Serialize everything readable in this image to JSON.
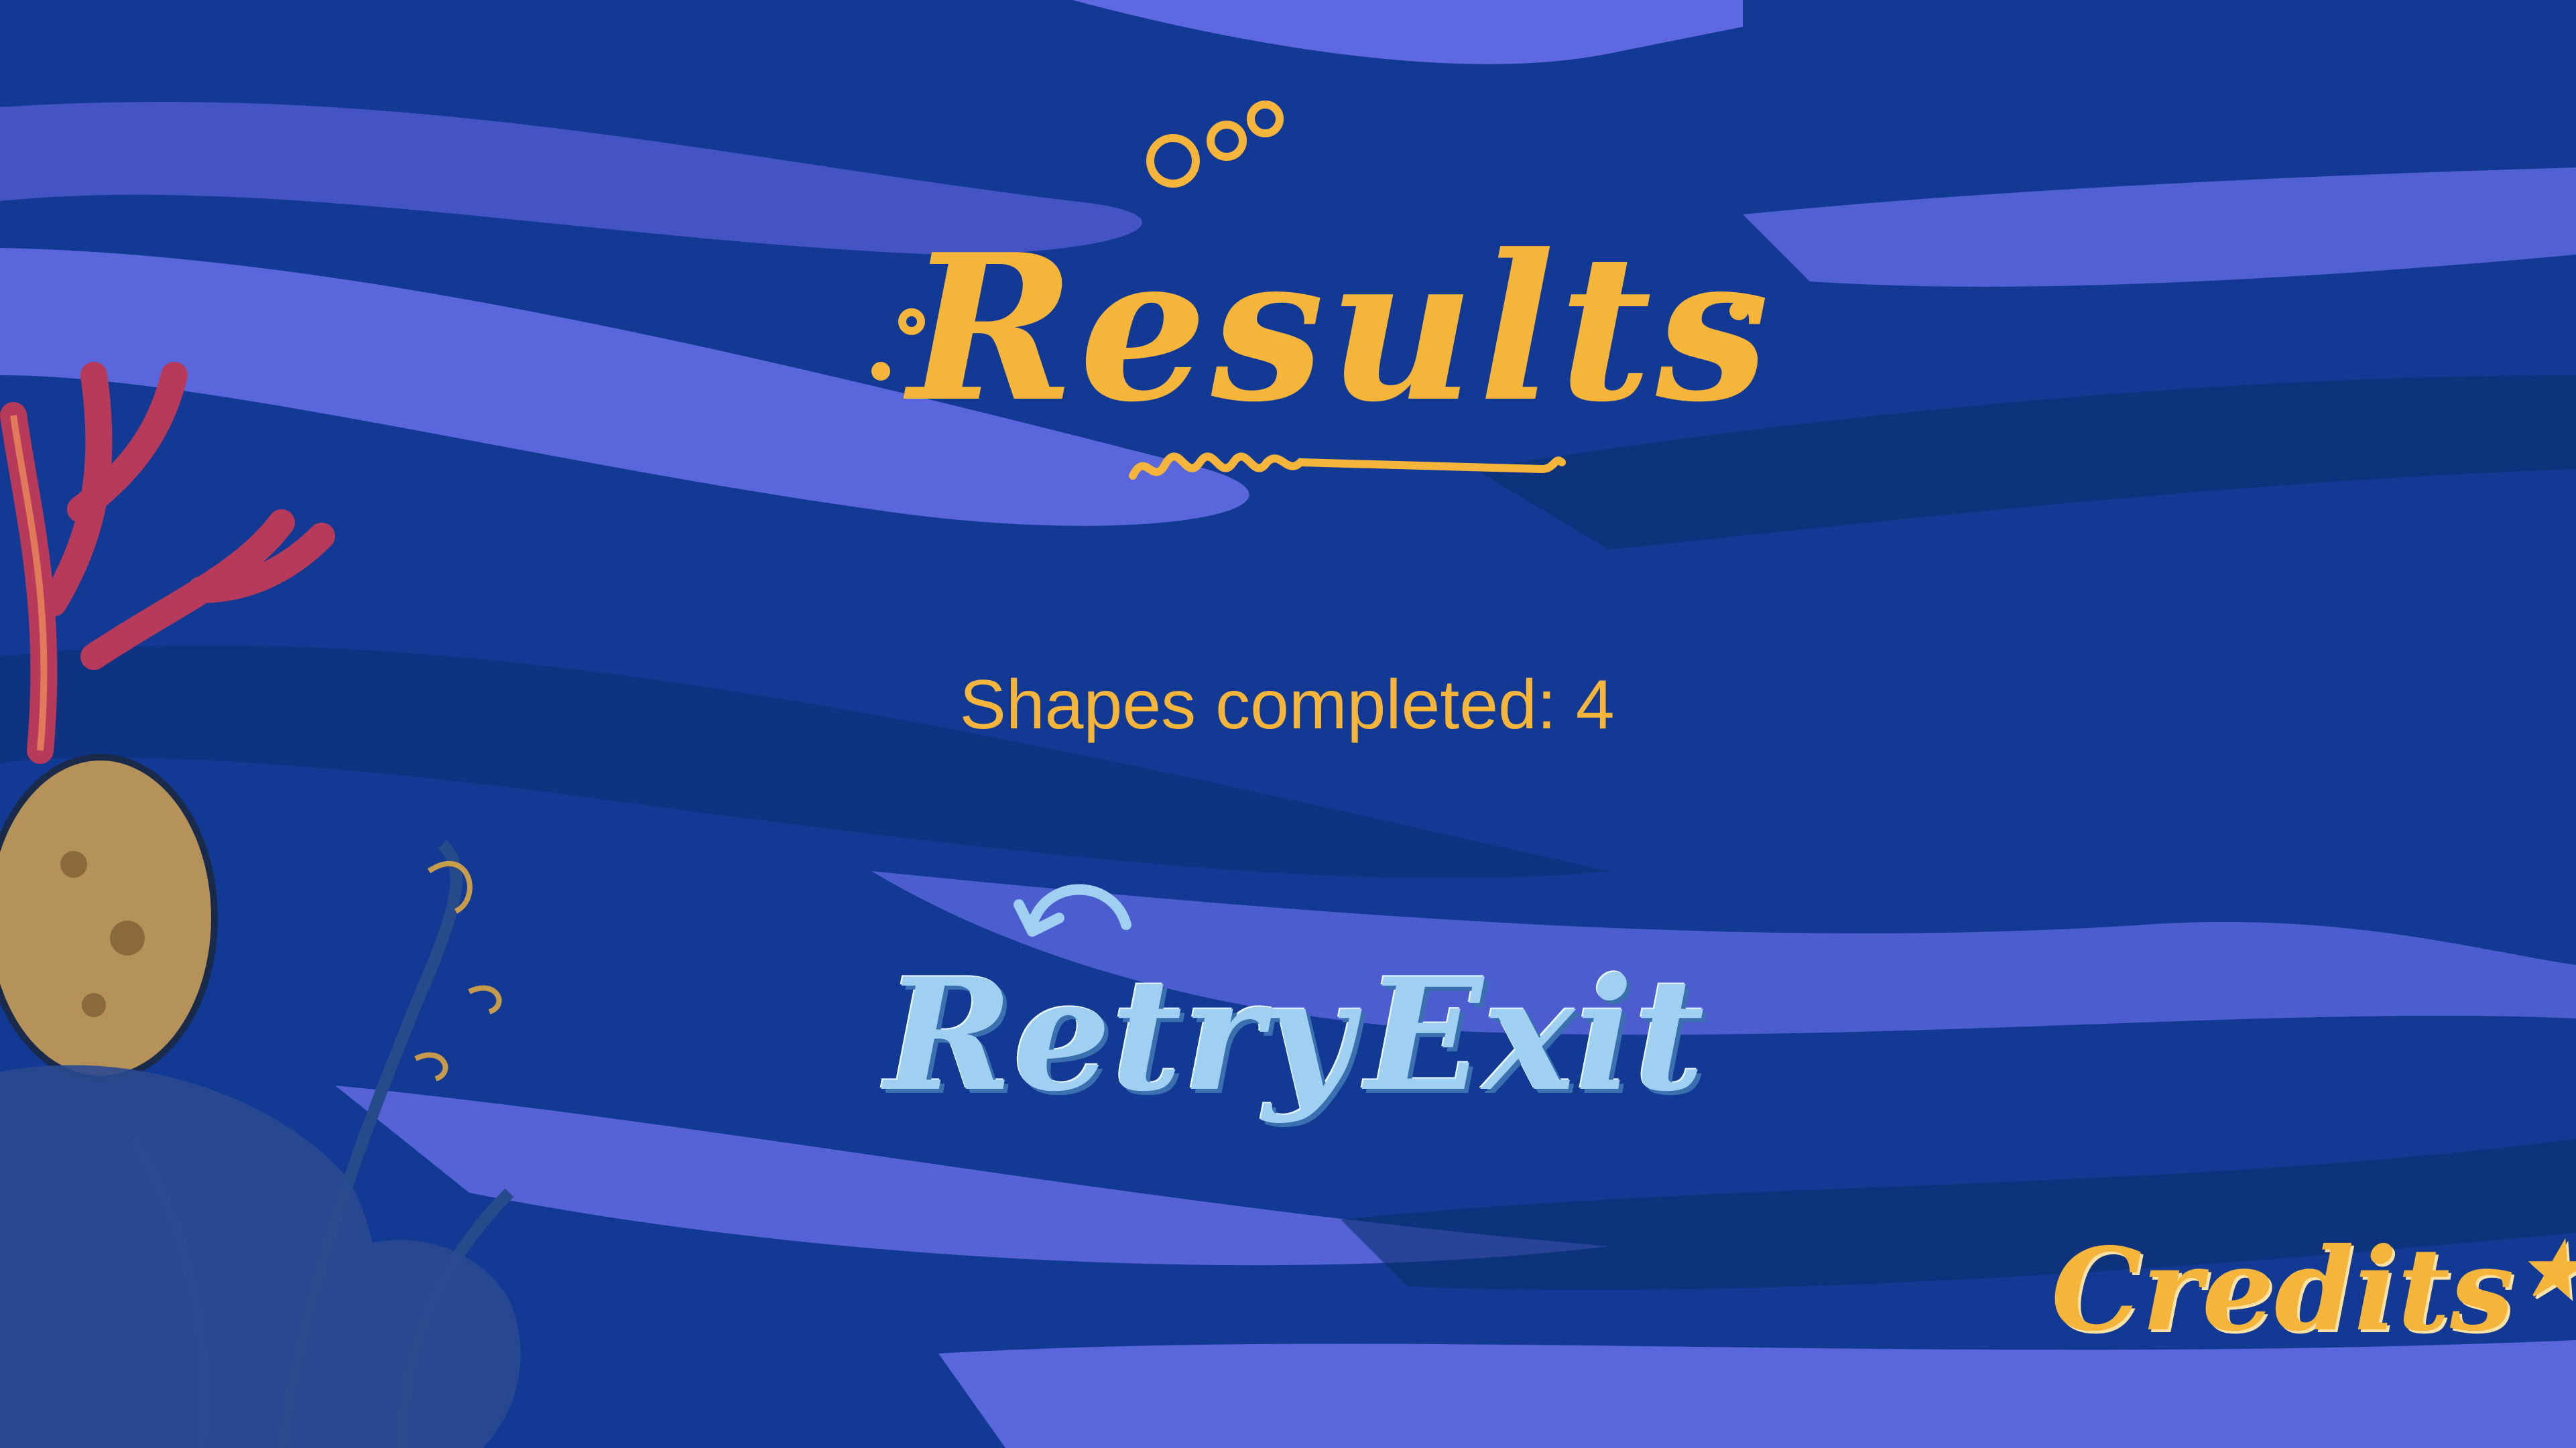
{
  "screen": {
    "title": "Results",
    "score_text": "Shapes completed: 4"
  },
  "buttons": {
    "retry_label": "Retry",
    "exit_label": "Exit",
    "credits_label": "Credits",
    "credits_star": "★"
  },
  "colors": {
    "background": "#123a94",
    "wave_light": "#6c72ee",
    "wave_dark": "#0a2e6e",
    "title_gold": "#f5b43a",
    "button_blue": "#9fd0f2",
    "coral": "#b83a5a"
  },
  "icons": {
    "retry": "retry-arrow-icon",
    "credits_star": "star-icon",
    "title_bubbles": "bubbles-icon"
  }
}
